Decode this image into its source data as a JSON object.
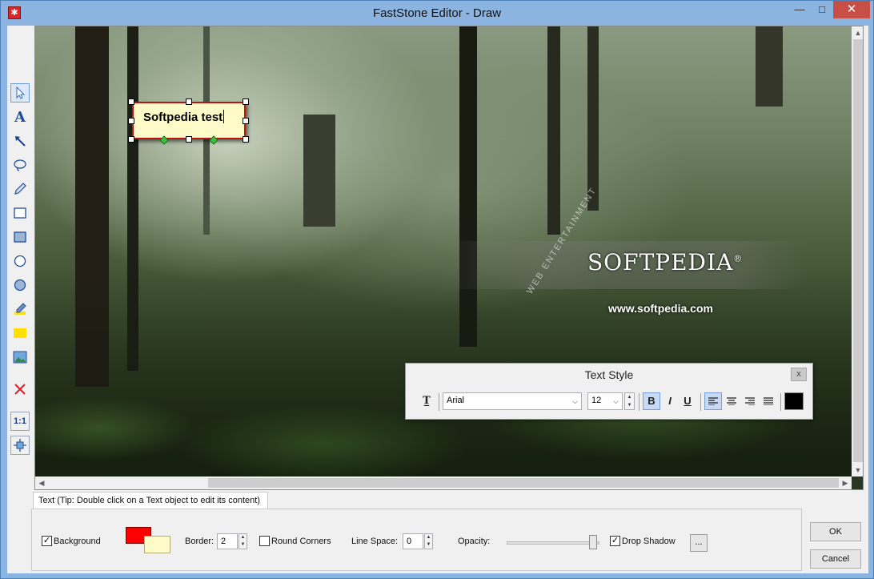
{
  "window": {
    "title": "FastStone Editor - Draw",
    "app_icon": "fs-icon",
    "buttons": [
      "minimize",
      "maximize",
      "close"
    ]
  },
  "toolbar": {
    "tools": [
      {
        "name": "select",
        "icon": "pointer-icon"
      },
      {
        "name": "text",
        "icon": "text-A-icon",
        "label": "A"
      },
      {
        "name": "arrow",
        "icon": "arrow-icon"
      },
      {
        "name": "lasso",
        "icon": "lasso-icon"
      },
      {
        "name": "pencil",
        "icon": "pencil-icon"
      },
      {
        "name": "rectangle",
        "icon": "rectangle-outline-icon"
      },
      {
        "name": "filled-rectangle",
        "icon": "rectangle-filled-icon"
      },
      {
        "name": "ellipse",
        "icon": "ellipse-outline-icon"
      },
      {
        "name": "filled-ellipse",
        "icon": "ellipse-filled-icon"
      },
      {
        "name": "highlighter",
        "icon": "highlighter-icon"
      },
      {
        "name": "fill",
        "icon": "yellow-rect-icon"
      },
      {
        "name": "image",
        "icon": "image-icon"
      },
      {
        "name": "delete",
        "icon": "red-x-icon"
      },
      {
        "name": "actual-size",
        "label": "1:1"
      },
      {
        "name": "fit",
        "icon": "fit-icon"
      }
    ]
  },
  "canvas": {
    "text_object": "Softpedia test",
    "watermark_logo": "SOFTPEDIA",
    "watermark_registered": "®",
    "watermark_url": "www.softpedia.com",
    "watermark_arc": "WEB ENTERTAINMENT"
  },
  "text_style": {
    "title": "Text Style",
    "close": "x",
    "font": "Arial",
    "size": "12",
    "bold_label": "B",
    "italic_label": "I",
    "underline_label": "U",
    "color": "#000000"
  },
  "bottom": {
    "tab_label": "Text (Tip: Double click on a Text object to edit its content)",
    "background_label": "Background",
    "background_checked": true,
    "border_label": "Border:",
    "border_value": "2",
    "round_corners_label": "Round Corners",
    "round_corners_checked": false,
    "line_space_label": "Line Space:",
    "line_space_value": "0",
    "opacity_label": "Opacity:",
    "opacity_fraction": 0.95,
    "drop_shadow_label": "Drop Shadow",
    "drop_shadow_checked": true,
    "more_label": "...",
    "border_color": "#ff0000",
    "fill_color": "#fffbc9"
  },
  "dialog": {
    "ok_label": "OK",
    "cancel_label": "Cancel"
  }
}
